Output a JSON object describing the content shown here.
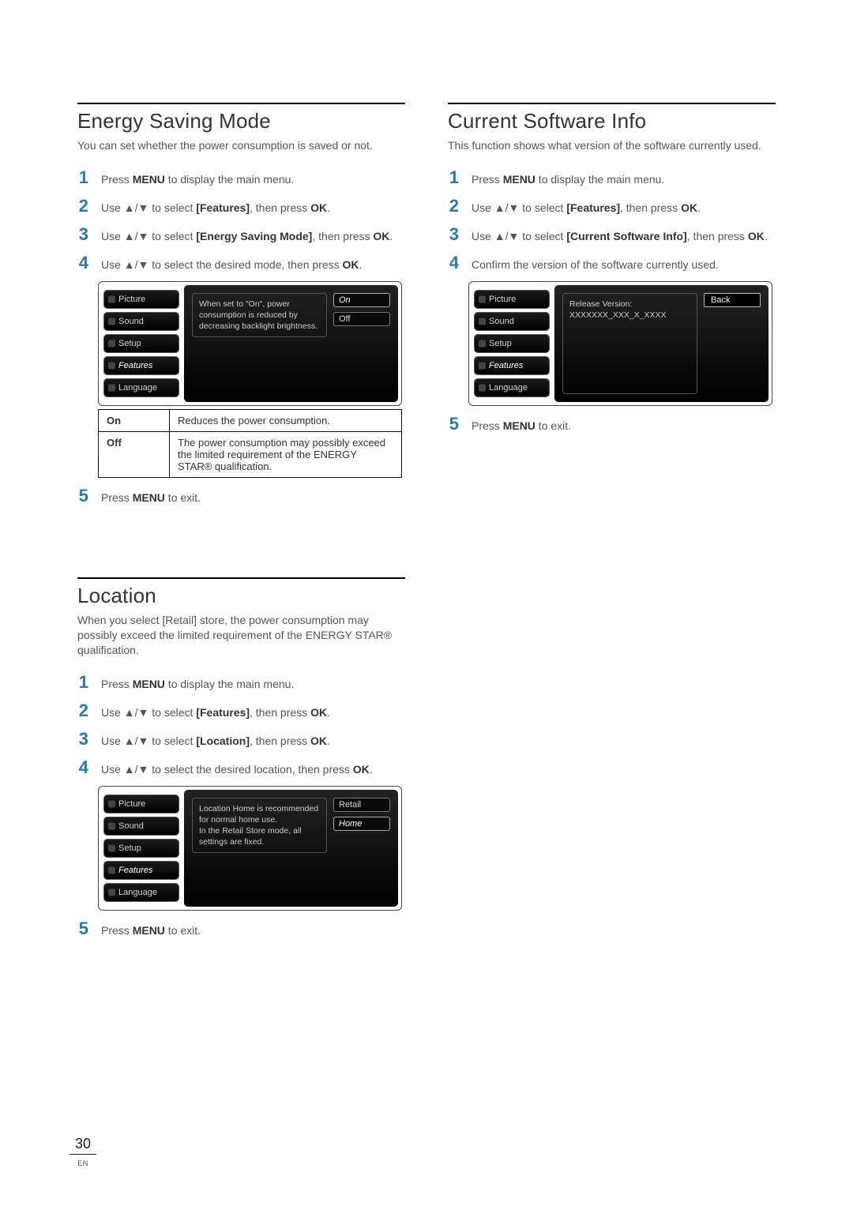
{
  "page": {
    "number": "30",
    "lang": "EN"
  },
  "arrows": "▲/▼",
  "energy": {
    "title": "Energy Saving Mode",
    "intro": "You can set whether the power consumption is saved or not.",
    "steps": {
      "s1_pre": "Press ",
      "s1_b": "MENU",
      "s1_post": " to display the main menu.",
      "s2_pre": "Use ",
      "s2_mid": " to select ",
      "s2_b": "[Features]",
      "s2_post": ", then press ",
      "s2_ok": "OK",
      "s2_end": ".",
      "s3_pre": "Use ",
      "s3_mid": " to select ",
      "s3_b": "[Energy Saving Mode]",
      "s3_post": ", then press ",
      "s3_ok": "OK",
      "s3_end": ".",
      "s4_pre": "Use ",
      "s4_mid": " to select the desired mode, then press ",
      "s4_ok": "OK",
      "s4_end": ".",
      "s5_pre": "Press ",
      "s5_b": "MENU",
      "s5_post": " to exit."
    },
    "menu": {
      "left": [
        "Picture",
        "Sound",
        "Setup",
        "Features",
        "Language"
      ],
      "desc": "When set to \"On\", power consumption is reduced by decreasing backlight brightness.",
      "opts": [
        "On",
        "Off"
      ],
      "selected": "On"
    },
    "table": {
      "on_k": "On",
      "on_v": "Reduces the power consumption.",
      "off_k": "Off",
      "off_v": "The power consumption may possibly exceed the limited requirement of the ENERGY STAR® qualification."
    }
  },
  "location": {
    "title": "Location",
    "intro_pre": "When you select ",
    "intro_b": "[Retail]",
    "intro_post": " store, the power consumption may possibly exceed the limited requirement of the ENERGY STAR® qualification.",
    "steps": {
      "s1_pre": "Press ",
      "s1_b": "MENU",
      "s1_post": " to display the main menu.",
      "s2_pre": "Use ",
      "s2_mid": " to select ",
      "s2_b": "[Features]",
      "s2_post": ", then press ",
      "s2_ok": "OK",
      "s2_end": ".",
      "s3_pre": "Use ",
      "s3_mid": " to select ",
      "s3_b": "[Location]",
      "s3_post": ", then press ",
      "s3_ok": "OK",
      "s3_end": ".",
      "s4_pre": "Use ",
      "s4_mid": " to select the desired location, then press ",
      "s4_ok": "OK",
      "s4_end": ".",
      "s5_pre": "Press ",
      "s5_b": "MENU",
      "s5_post": " to exit."
    },
    "menu": {
      "left": [
        "Picture",
        "Sound",
        "Setup",
        "Features",
        "Language"
      ],
      "desc": "Location Home is recommended for normal home use.\nIn the Retail Store mode, all settings are fixed.",
      "opts": [
        "Retail",
        "Home"
      ],
      "selected": "Home"
    }
  },
  "csi": {
    "title": "Current Software Info",
    "intro": "This function shows what version of the software currently used.",
    "steps": {
      "s1_pre": "Press ",
      "s1_b": "MENU",
      "s1_post": " to display the main menu.",
      "s2_pre": "Use ",
      "s2_mid": " to select ",
      "s2_b": "[Features]",
      "s2_post": ", then press ",
      "s2_ok": "OK",
      "s2_end": ".",
      "s3_pre": "Use ",
      "s3_mid": " to select ",
      "s3_b": "[Current Software Info]",
      "s3_post": ", then press ",
      "s3_ok": "OK",
      "s3_end": ".",
      "s4": "Confirm the version of the software currently used.",
      "s5_pre": "Press ",
      "s5_b": "MENU",
      "s5_post": " to exit."
    },
    "menu": {
      "left": [
        "Picture",
        "Sound",
        "Setup",
        "Features",
        "Language"
      ],
      "desc": "Release Version:\nXXXXXXX_XXX_X_XXXX",
      "back": "Back"
    }
  }
}
